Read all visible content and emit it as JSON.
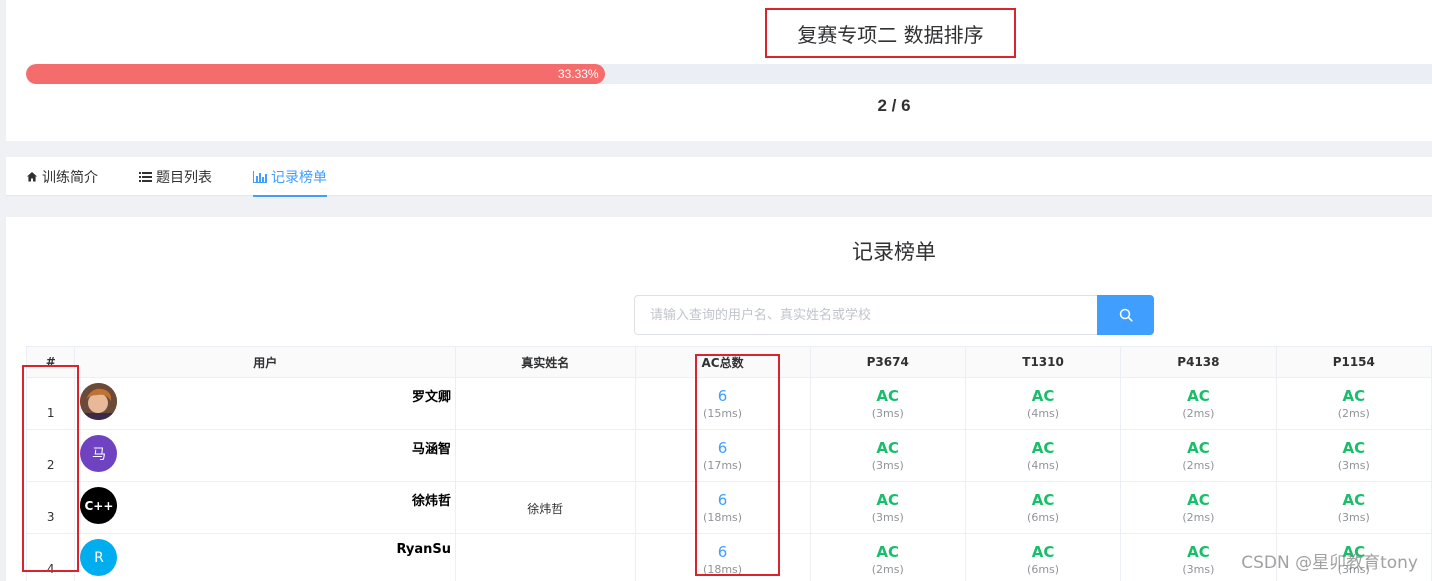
{
  "contest": {
    "title": "复赛专项二 数据排序",
    "progress_percent": 33.33,
    "progress_label": "33.33%",
    "progress_count": "2 / 6"
  },
  "tabs": [
    {
      "label": "训练简介",
      "icon": "home-icon"
    },
    {
      "label": "题目列表",
      "icon": "list-icon"
    },
    {
      "label": "记录榜单",
      "icon": "bar-chart-icon",
      "active": true
    }
  ],
  "ranking": {
    "title": "记录榜单",
    "search_placeholder": "请输入查询的用户名、真实姓名或学校",
    "columns": [
      "#",
      "用户",
      "真实姓名",
      "AC总数",
      "P3674",
      "T1310",
      "P4138",
      "P1154"
    ],
    "rows": [
      {
        "rank": "1",
        "user": "罗文卿",
        "avatar_text": "",
        "avatar_color": "#8a5a44",
        "real_name": "",
        "ac_total": "6",
        "total_time": "(15ms)",
        "problems": [
          {
            "status": "AC",
            "time": "(3ms)"
          },
          {
            "status": "AC",
            "time": "(4ms)"
          },
          {
            "status": "AC",
            "time": "(2ms)"
          },
          {
            "status": "AC",
            "time": "(2ms)"
          }
        ]
      },
      {
        "rank": "2",
        "user": "马涵智",
        "avatar_text": "马",
        "avatar_color": "#6f42c1",
        "real_name": "",
        "ac_total": "6",
        "total_time": "(17ms)",
        "problems": [
          {
            "status": "AC",
            "time": "(3ms)"
          },
          {
            "status": "AC",
            "time": "(4ms)"
          },
          {
            "status": "AC",
            "time": "(2ms)"
          },
          {
            "status": "AC",
            "time": "(3ms)"
          }
        ]
      },
      {
        "rank": "3",
        "user": "徐炜哲",
        "avatar_text": "C++",
        "avatar_color": "#000000",
        "real_name": "徐炜哲",
        "ac_total": "6",
        "total_time": "(18ms)",
        "problems": [
          {
            "status": "AC",
            "time": "(3ms)"
          },
          {
            "status": "AC",
            "time": "(6ms)"
          },
          {
            "status": "AC",
            "time": "(2ms)"
          },
          {
            "status": "AC",
            "time": "(3ms)"
          }
        ]
      },
      {
        "rank": "4",
        "user": "RyanSu",
        "avatar_text": "R",
        "avatar_color": "#00aeef",
        "real_name": "",
        "ac_total": "6",
        "total_time": "(18ms)",
        "problems": [
          {
            "status": "AC",
            "time": "(2ms)"
          },
          {
            "status": "AC",
            "time": "(6ms)"
          },
          {
            "status": "AC",
            "time": "(3ms)"
          },
          {
            "status": "AC",
            "time": "(3ms)"
          }
        ]
      }
    ]
  },
  "watermark": "CSDN @星卯教育tony",
  "colors": {
    "accent": "#409eff",
    "progress": "#f56c6c",
    "ac_green": "#19be6b",
    "highlight_box": "#d9232d"
  }
}
